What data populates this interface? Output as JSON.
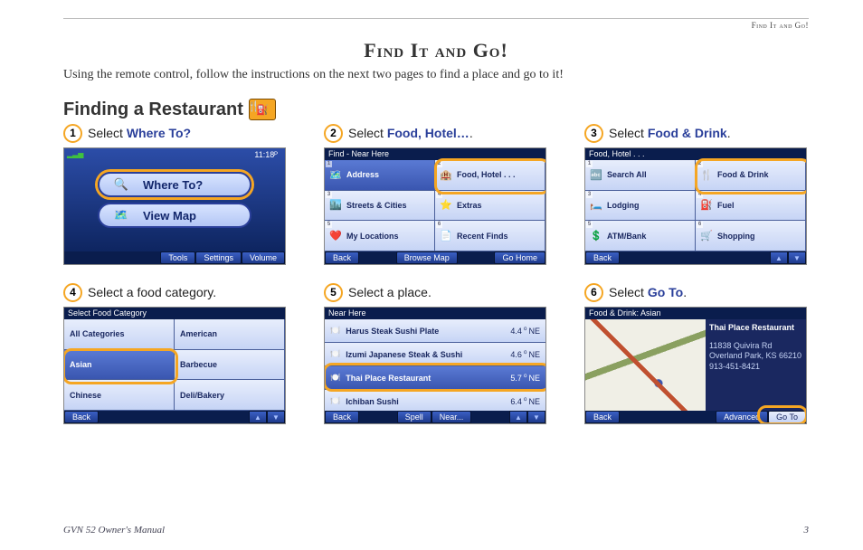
{
  "running_head": "Find It and Go!",
  "title": "Find It and Go!",
  "intro": "Using the remote control, follow the instructions on the next two pages to find a place and go to it!",
  "section": {
    "heading": "Finding a Restaurant"
  },
  "footer": {
    "left": "GVN 52 Owner's Manual",
    "right": "3"
  },
  "steps": [
    {
      "num": "1",
      "pre": "Select ",
      "hl": "Where To?",
      "post": "",
      "shot": {
        "time": "11:18ᴾ",
        "buttons": [
          "Where To?",
          "View Map"
        ],
        "footer": [
          "Tools",
          "Settings",
          "Volume"
        ]
      }
    },
    {
      "num": "2",
      "pre": "Select ",
      "hl": "Food, Hotel…",
      "post": ".",
      "shot": {
        "header": "Find - Near Here",
        "items": [
          {
            "key": "1",
            "icon": "🗺️",
            "label": "Address"
          },
          {
            "key": "2",
            "icon": "🏨",
            "label": "Food, Hotel . . ."
          },
          {
            "key": "3",
            "icon": "🏙️",
            "label": "Streets & Cities"
          },
          {
            "key": "4",
            "icon": "⭐",
            "label": "Extras"
          },
          {
            "key": "5",
            "icon": "❤️",
            "label": "My Locations"
          },
          {
            "key": "6",
            "icon": "📄",
            "label": "Recent Finds"
          }
        ],
        "footer": [
          "Back",
          "Browse Map",
          "Go Home"
        ]
      }
    },
    {
      "num": "3",
      "pre": "Select ",
      "hl": "Food & Drink",
      "post": ".",
      "shot": {
        "header": "Food, Hotel . . .",
        "items": [
          {
            "key": "1",
            "icon": "🔤",
            "label": "Search All"
          },
          {
            "key": "2",
            "icon": "🍴",
            "label": "Food & Drink"
          },
          {
            "key": "3",
            "icon": "🛏️",
            "label": "Lodging"
          },
          {
            "key": "4",
            "icon": "⛽",
            "label": "Fuel"
          },
          {
            "key": "5",
            "icon": "💲",
            "label": "ATM/Bank"
          },
          {
            "key": "6",
            "icon": "🛒",
            "label": "Shopping"
          }
        ],
        "footer": [
          "Back"
        ]
      }
    },
    {
      "num": "4",
      "pre": "Select a food category.",
      "hl": "",
      "post": "",
      "shot": {
        "header": "Select Food Category",
        "items": [
          {
            "label": "All Categories"
          },
          {
            "label": "American"
          },
          {
            "label": "Asian"
          },
          {
            "label": "Barbecue"
          },
          {
            "label": "Chinese"
          },
          {
            "label": "Deli/Bakery"
          }
        ],
        "footer": [
          "Back"
        ]
      }
    },
    {
      "num": "5",
      "pre": "Select a place.",
      "hl": "",
      "post": "",
      "shot": {
        "header": "Near Here",
        "items": [
          {
            "icon": "🍽️",
            "label": "Harus Steak Sushi Plate",
            "dist": "4.4",
            "dir": "NE"
          },
          {
            "icon": "🍽️",
            "label": "Izumi Japanese Steak & Sushi",
            "dist": "4.6",
            "dir": "NE"
          },
          {
            "icon": "🍽️",
            "label": "Thai Place Restaurant",
            "dist": "5.7",
            "dir": "NE"
          },
          {
            "icon": "🍽️",
            "label": "Ichiban Sushi",
            "dist": "6.4",
            "dir": "NE"
          }
        ],
        "footer": [
          "Back",
          "Spell",
          "Near..."
        ]
      }
    },
    {
      "num": "6",
      "pre": "Select ",
      "hl": "Go To",
      "post": ".",
      "shot": {
        "header": "Food & Drink: Asian",
        "place_name": "Thai Place Restaurant",
        "addr1": "11838 Quivira Rd",
        "addr2": "Overland Park, KS 66210",
        "phone": "913-451-8421",
        "footer": [
          "Back",
          "Advanced",
          "Go To"
        ]
      }
    }
  ]
}
